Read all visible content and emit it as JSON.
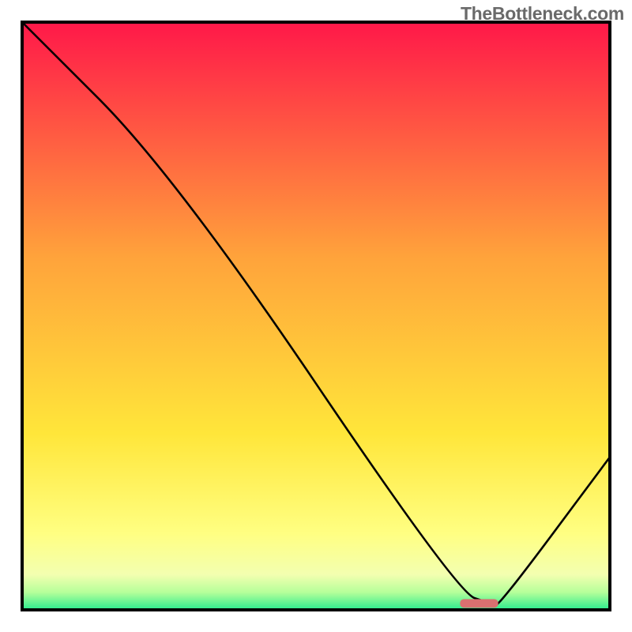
{
  "watermark": "TheBottleneck.com",
  "chart_data": {
    "type": "line",
    "title": "",
    "xlabel": "",
    "ylabel": "",
    "xlim": [
      0,
      100
    ],
    "ylim": [
      0,
      100
    ],
    "x": [
      0,
      26,
      74,
      80,
      81,
      100
    ],
    "y": [
      100,
      74,
      3,
      1,
      0.5,
      26
    ],
    "marker": {
      "x_start": 74.5,
      "x_end": 81,
      "y": 1.1,
      "color": "#d97070"
    },
    "background_gradient": {
      "stops": [
        {
          "offset": 0,
          "color": "#ff1849"
        },
        {
          "offset": 40,
          "color": "#ffa33b"
        },
        {
          "offset": 70,
          "color": "#ffe63a"
        },
        {
          "offset": 87,
          "color": "#ffff82"
        },
        {
          "offset": 94,
          "color": "#f3ffb0"
        },
        {
          "offset": 97,
          "color": "#b6ff9a"
        },
        {
          "offset": 100,
          "color": "#29ec8e"
        }
      ]
    },
    "frame_color": "#000000"
  }
}
